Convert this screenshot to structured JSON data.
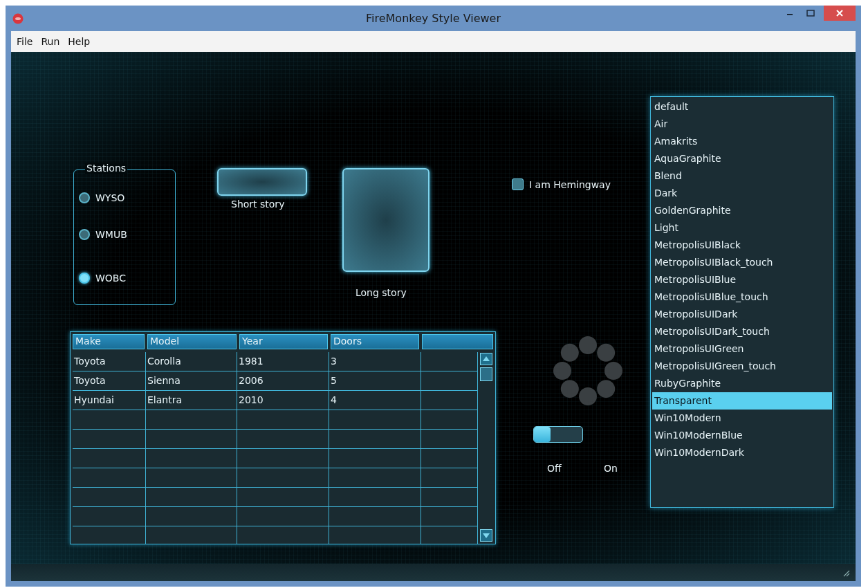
{
  "window": {
    "title": "FireMonkey Style Viewer"
  },
  "menu": [
    "File",
    "Run",
    "Help"
  ],
  "stations": {
    "title": "Stations",
    "options": [
      {
        "label": "WYSO",
        "selected": false
      },
      {
        "label": "WMUB",
        "selected": false
      },
      {
        "label": "WOBC",
        "selected": true
      }
    ]
  },
  "buttons": [
    {
      "label": "Short story",
      "kind": "short"
    },
    {
      "label": "Long story",
      "kind": "tall"
    }
  ],
  "checkbox": {
    "label": "I am Hemingway",
    "checked": false
  },
  "table": {
    "columns": [
      "Make",
      "Model",
      "Year",
      "Doors"
    ],
    "rows": [
      [
        "Toyota",
        "Corolla",
        "1981",
        "3"
      ],
      [
        "Toyota",
        "Sienna",
        "2006",
        "5"
      ],
      [
        "Hyundai",
        "Elantra",
        "2010",
        "4"
      ]
    ]
  },
  "switch": {
    "on": false,
    "off_label": "Off",
    "on_label": "On"
  },
  "styles": [
    {
      "label": "default",
      "selected": false
    },
    {
      "label": "Air",
      "selected": false
    },
    {
      "label": "Amakrits",
      "selected": false
    },
    {
      "label": "AquaGraphite",
      "selected": false
    },
    {
      "label": "Blend",
      "selected": false
    },
    {
      "label": "Dark",
      "selected": false
    },
    {
      "label": "GoldenGraphite",
      "selected": false
    },
    {
      "label": "Light",
      "selected": false
    },
    {
      "label": "MetropolisUIBlack",
      "selected": false
    },
    {
      "label": "MetropolisUIBlack_touch",
      "selected": false
    },
    {
      "label": "MetropolisUIBlue",
      "selected": false
    },
    {
      "label": "MetropolisUIBlue_touch",
      "selected": false
    },
    {
      "label": "MetropolisUIDark",
      "selected": false
    },
    {
      "label": "MetropolisUIDark_touch",
      "selected": false
    },
    {
      "label": "MetropolisUIGreen",
      "selected": false
    },
    {
      "label": "MetropolisUIGreen_touch",
      "selected": false
    },
    {
      "label": "RubyGraphite",
      "selected": false
    },
    {
      "label": "Transparent",
      "selected": true
    },
    {
      "label": "Win10Modern",
      "selected": false
    },
    {
      "label": "Win10ModernBlue",
      "selected": false
    },
    {
      "label": "Win10ModernDark",
      "selected": false
    }
  ]
}
